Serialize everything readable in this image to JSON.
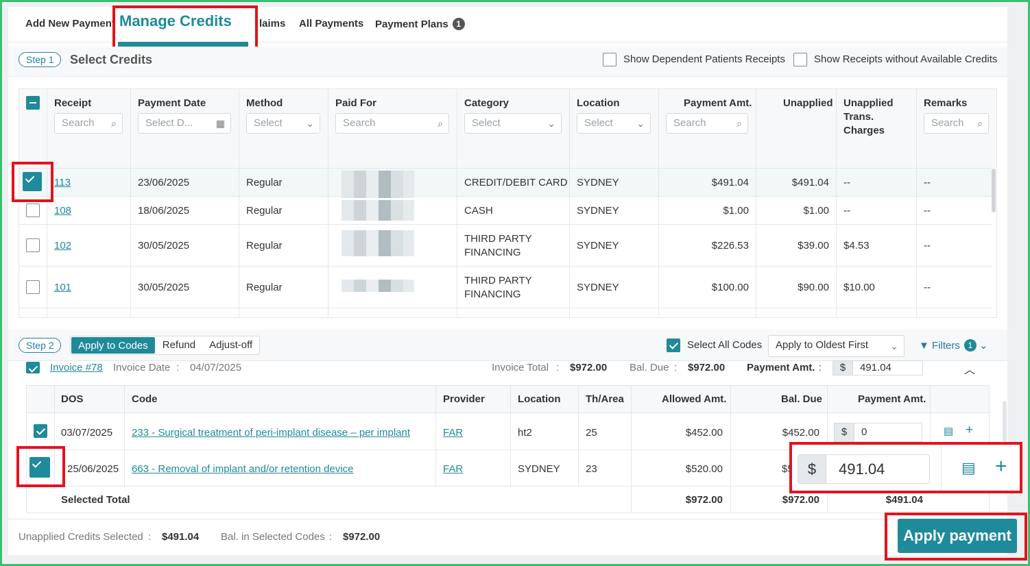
{
  "tabs": {
    "add_new": "Add New Payment",
    "manage_credits": "Manage Credits",
    "claims": "laims",
    "all_payments": "All Payments",
    "payment_plans": "Payment Plans",
    "payment_plans_badge": "1"
  },
  "step1": {
    "pill": "Step 1",
    "title": "Select Credits",
    "show_dependent": "Show Dependent Patients Receipts",
    "show_without_credits": "Show Receipts without Available Credits"
  },
  "credits_table": {
    "headers": {
      "receipt": "Receipt",
      "payment_date": "Payment Date",
      "method": "Method",
      "paid_for": "Paid For",
      "category": "Category",
      "location": "Location",
      "payment_amt": "Payment Amt.",
      "unapplied": "Unapplied",
      "unapplied_trans_1": "Unapplied",
      "unapplied_trans_2": "Trans.",
      "unapplied_trans_3": "Charges",
      "remarks": "Remarks"
    },
    "filters": {
      "search": "Search",
      "select_date": "Select D...",
      "select": "Select"
    },
    "rows": [
      {
        "receipt": "113",
        "date": "23/06/2025",
        "method": "Regular",
        "category": "CREDIT/DEBIT CARD",
        "category2": "",
        "location": "SYDNEY",
        "payment_amt": "$491.04",
        "unapplied": "$491.04",
        "trans": "--",
        "remarks": "--"
      },
      {
        "receipt": "108",
        "date": "18/06/2025",
        "method": "Regular",
        "category": "CASH",
        "category2": "",
        "location": "SYDNEY",
        "payment_amt": "$1.00",
        "unapplied": "$1.00",
        "trans": "--",
        "remarks": "--"
      },
      {
        "receipt": "102",
        "date": "30/05/2025",
        "method": "Regular",
        "category": "THIRD PARTY",
        "category2": "FINANCING",
        "location": "SYDNEY",
        "payment_amt": "$226.53",
        "unapplied": "$39.00",
        "trans": "$4.53",
        "remarks": "--"
      },
      {
        "receipt": "101",
        "date": "30/05/2025",
        "method": "Regular",
        "category": "THIRD PARTY",
        "category2": "FINANCING",
        "location": "SYDNEY",
        "payment_amt": "$100.00",
        "unapplied": "$90.00",
        "trans": "$10.00",
        "remarks": "--"
      }
    ]
  },
  "step2": {
    "pill": "Step 2",
    "apply_to_codes": "Apply to Codes",
    "refund": "Refund",
    "adjust_off": "Adjust-off",
    "select_all_codes": "Select All Codes",
    "apply_order": "Apply to Oldest First",
    "filters": "Filters",
    "filters_badge": "1"
  },
  "invoice": {
    "link": "Invoice #78",
    "date_label": "Invoice Date",
    "sep": ":",
    "date": "04/07/2025",
    "total_label": "Invoice Total",
    "total": "$972.00",
    "bal_label": "Bal. Due",
    "bal": "$972.00",
    "pay_label": "Payment Amt.",
    "pay_currency": "$",
    "pay_value": "491.04"
  },
  "codes_table": {
    "headers": {
      "dos": "DOS",
      "code": "Code",
      "provider": "Provider",
      "location": "Location",
      "th_area": "Th/Area",
      "allowed": "Allowed Amt.",
      "bal_due": "Bal. Due",
      "payment_amt": "Payment Amt."
    },
    "rows": [
      {
        "dos": "03/07/2025",
        "code": "233 - Surgical treatment of peri-implant disease – per implant",
        "provider": "FAR",
        "location": "ht2",
        "th": "25",
        "allowed": "$452.00",
        "bal": "$452.00",
        "currency": "$",
        "payment": "0"
      },
      {
        "dos": "25/06/2025",
        "code": "663 - Removal of implant and/or retention device",
        "provider": "FAR",
        "location": "SYDNEY",
        "th": "23",
        "allowed": "$520.00",
        "bal": "$5",
        "currency": "$",
        "payment": "491.04"
      }
    ],
    "selected_total_label": "Selected Total",
    "selected_allowed": "$972.00",
    "selected_bal": "$972.00",
    "selected_payment": "$491.04"
  },
  "footer": {
    "unapplied_label": "Unapplied Credits Selected",
    "sep": ":",
    "unapplied_value": "$491.04",
    "bal_label": "Bal. in Selected Codes",
    "bal_value": "$972.00",
    "apply_button": "Apply payment"
  },
  "colors": {
    "accent": "#1f8a9a",
    "highlight": "#e0141e",
    "frame": "#3bbf6e"
  }
}
